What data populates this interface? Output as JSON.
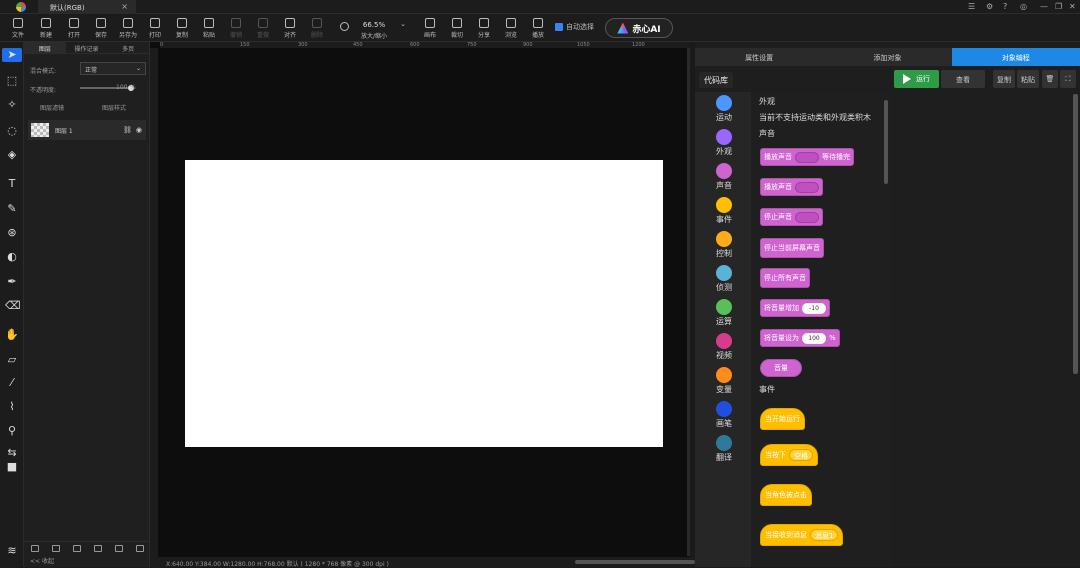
{
  "tabbar": {
    "document_tab": "默认(RGB)",
    "close_icon": "close-icon",
    "window_controls": [
      "menu-icon",
      "settings-icon",
      "help-icon",
      "compass-icon",
      "minimize-icon",
      "restore-icon",
      "close-icon"
    ]
  },
  "toolbar": {
    "items": [
      {
        "label": "文件",
        "icon": "file-icon"
      },
      {
        "label": "新建",
        "icon": "new-icon"
      },
      {
        "label": "打开",
        "icon": "open-icon"
      },
      {
        "label": "保存",
        "icon": "save-icon"
      },
      {
        "label": "另存为",
        "icon": "save-as-icon"
      },
      {
        "label": "打印",
        "icon": "print-icon"
      },
      {
        "label": "复制",
        "icon": "copy-icon"
      },
      {
        "label": "粘贴",
        "icon": "paste-icon"
      },
      {
        "label": "撤销",
        "icon": "undo-icon",
        "disabled": true
      },
      {
        "label": "重做",
        "icon": "redo-icon",
        "disabled": true
      },
      {
        "label": "对齐",
        "icon": "align-icon"
      },
      {
        "label": "删除",
        "icon": "delete-icon",
        "disabled": true
      },
      {
        "label": "画布",
        "icon": "canvas-icon"
      },
      {
        "label": "裁切",
        "icon": "crop-icon"
      },
      {
        "label": "分享",
        "icon": "share-icon"
      },
      {
        "label": "浏览",
        "icon": "browse-icon"
      },
      {
        "label": "播放",
        "icon": "play-icon"
      }
    ],
    "zoom": {
      "value": "66.5%",
      "label": "放大/缩小"
    },
    "auto_select": "自动选择",
    "ai_button": "赤心AI"
  },
  "layers_panel": {
    "tabs": [
      "图层",
      "操作记录",
      "多页"
    ],
    "blend_label": "混合模式:",
    "blend_value": "正常",
    "opacity_label": "不透明度:",
    "opacity_value": "100",
    "opacity_unit": "%",
    "opt1": "图层滤镜",
    "opt2": "图层样式",
    "layer_name": "图层 1"
  },
  "ruler": {
    "ticks": [
      "0",
      "150",
      "300",
      "450",
      "600",
      "750",
      "900",
      "1050",
      "1200"
    ]
  },
  "status": {
    "text": "X:640.00 Y:384.00 W:1280.00 H:768.00  默认 ( 1280 * 768 像素 @ 300 dpi )",
    "bottom_left": "<< 收起"
  },
  "right_panel": {
    "tabs": [
      "属性设置",
      "添加对象",
      "对象编程"
    ],
    "code_lib": "代码库",
    "run": "运行",
    "view": "查看",
    "copy": "复制",
    "paste": "粘贴",
    "categories": [
      {
        "label": "运动",
        "color": "#4c97ff"
      },
      {
        "label": "外观",
        "color": "#9966ff"
      },
      {
        "label": "声音",
        "color": "#cf63cf"
      },
      {
        "label": "事件",
        "color": "#ffbf00"
      },
      {
        "label": "控制",
        "color": "#ffab19"
      },
      {
        "label": "侦测",
        "color": "#5cb1d6"
      },
      {
        "label": "运算",
        "color": "#59c059"
      },
      {
        "label": "视频",
        "color": "#d63c8c"
      },
      {
        "label": "变量",
        "color": "#ff8c1a"
      },
      {
        "label": "画笔",
        "color": "#1e4fe0"
      },
      {
        "label": "翻译",
        "color": "#2f7a9a"
      }
    ],
    "palette": {
      "looks_title": "外观",
      "looks_note": "当前不支持运动类和外观类积木",
      "sound_title": "声音",
      "sound_blocks": [
        {
          "text": "播放声音",
          "suffix": "等待播完"
        },
        {
          "text": "播放声音"
        },
        {
          "text": "停止声音"
        },
        {
          "text": "停止当前屏幕声音"
        },
        {
          "text": "停止所有声音"
        },
        {
          "text": "将音量增加",
          "value": "-10"
        },
        {
          "text": "将音量设为",
          "value": "100",
          "suffix": "%"
        },
        {
          "text": "音量"
        }
      ],
      "events_title": "事件",
      "event_blocks": [
        {
          "text": "当开始运行"
        },
        {
          "text": "当按下",
          "drop": "空格"
        },
        {
          "text": "当角色被点击"
        },
        {
          "text": "当接收到消息",
          "drop": "消息1"
        }
      ]
    }
  }
}
